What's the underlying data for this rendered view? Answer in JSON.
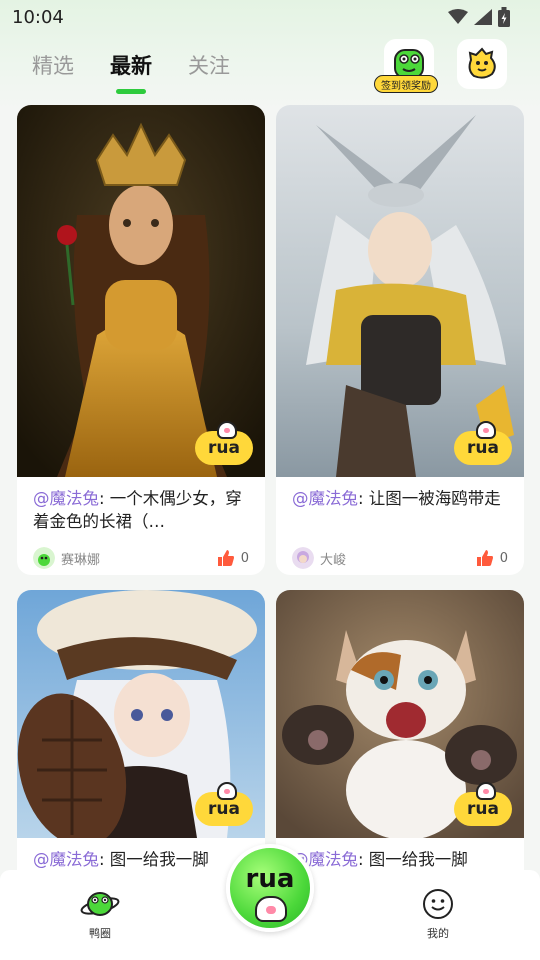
{
  "status": {
    "time": "10:04"
  },
  "tabs": [
    {
      "label": "精选",
      "active": false
    },
    {
      "label": "最新",
      "active": true
    },
    {
      "label": "关注",
      "active": false
    }
  ],
  "header": {
    "checkin_label": "签到领奖励"
  },
  "cards": [
    {
      "mention": "@魔法兔",
      "text": ": 一个木偶少女，穿着金色的长裙（…",
      "author": "赛琳娜",
      "likes": "0",
      "badge": "rua"
    },
    {
      "mention": "@魔法兔",
      "text": ": 让图一被海鸥带走",
      "author": "大峻",
      "likes": "0",
      "badge": "rua"
    },
    {
      "mention": "@魔法兔",
      "text": ": 图一给我一脚",
      "author": "",
      "likes": "",
      "badge": "rua"
    },
    {
      "mention": "@魔法兔",
      "text": ": 图一给我一脚",
      "author": "",
      "likes": "",
      "badge": "rua"
    }
  ],
  "bottom_nav": {
    "left_label": "鸭圈",
    "center_label": "rua",
    "right_label": "我的"
  },
  "colors": {
    "accent": "#2ecb3d",
    "mention": "#8a6bd6",
    "like": "#ff5a3c",
    "badge": "#ffd83a"
  }
}
